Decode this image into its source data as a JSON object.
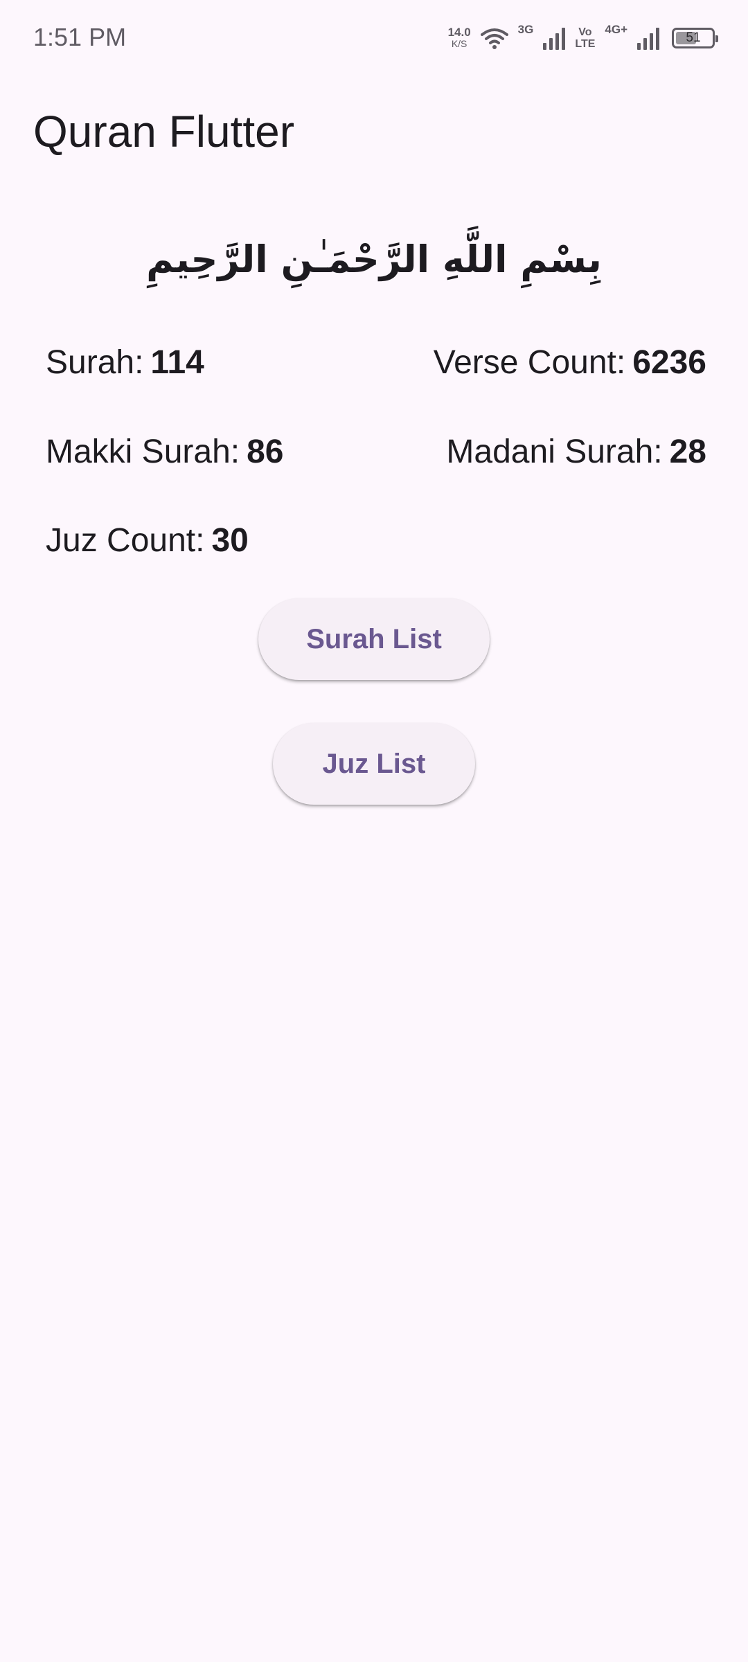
{
  "status_bar": {
    "time": "1:51 PM",
    "net_speed_value": "14.0",
    "net_speed_unit": "K/S",
    "network_3g": "3G",
    "volte_top": "Vo",
    "volte_bottom": "LTE",
    "network_4g": "4G+",
    "battery_level": "51",
    "icons": [
      "wifi-icon",
      "signal-icon",
      "signal-icon",
      "battery-icon"
    ]
  },
  "app_bar": {
    "title": "Quran Flutter"
  },
  "bismillah": "بِسْمِ اللَّهِ الرَّحْمَـٰنِ الرَّحِيمِ",
  "stats": {
    "surah_label": "Surah:",
    "surah_value": "114",
    "verse_label": "Verse Count:",
    "verse_value": "6236",
    "makki_label": "Makki Surah:",
    "makki_value": "86",
    "madani_label": "Madani Surah:",
    "madani_value": "28",
    "juz_label": "Juz Count:",
    "juz_value": "30"
  },
  "buttons": {
    "surah_list": "Surah List",
    "juz_list": "Juz List"
  },
  "colors": {
    "background": "#fdf7fd",
    "button_background": "#f6eff6",
    "button_text": "#6a5890",
    "text": "#1d1b20"
  }
}
